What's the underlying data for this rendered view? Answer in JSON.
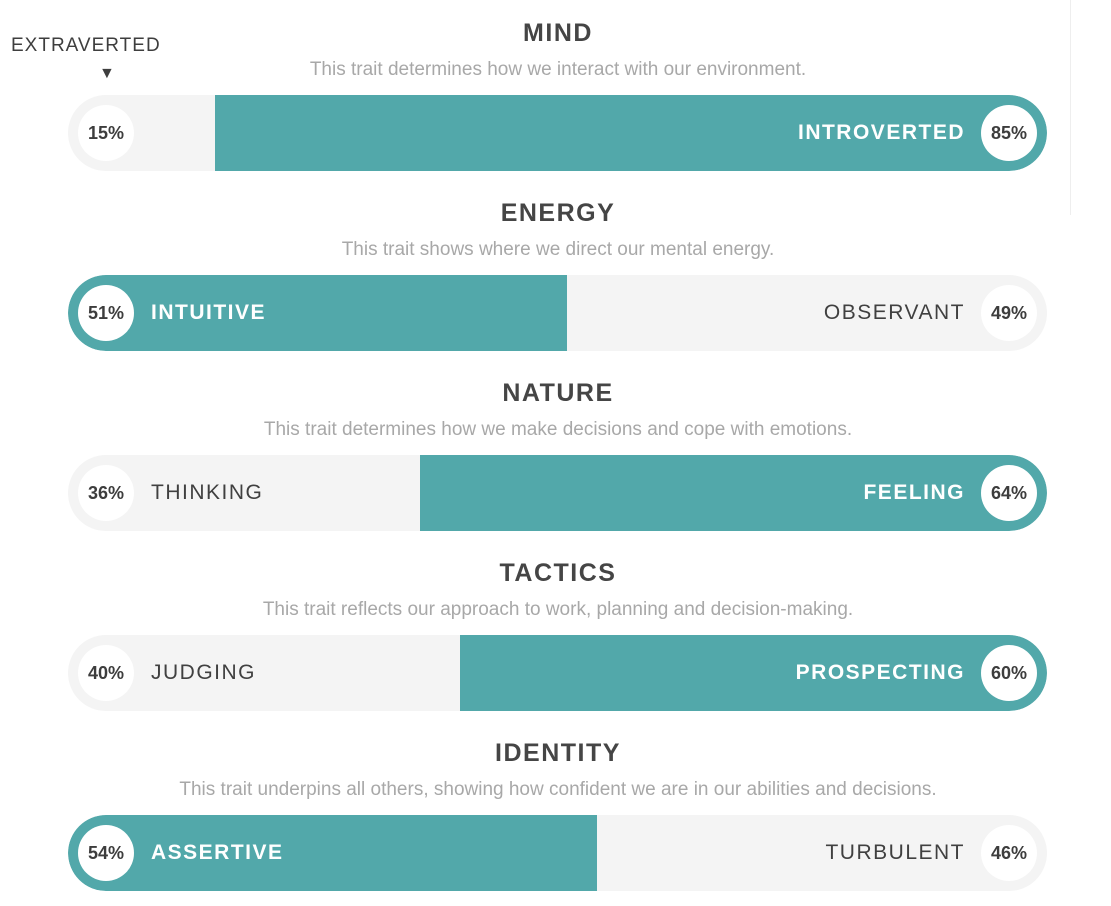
{
  "marker": {
    "label": "EXTRAVERTED",
    "arrow": "▼"
  },
  "colors": {
    "fill": "#52a8aa",
    "track": "#f4f4f4",
    "text_dark": "#454545",
    "text_muted": "#a8a8a8"
  },
  "traits": [
    {
      "title": "MIND",
      "description": "This trait determines how we interact with our environment.",
      "left": {
        "label": "",
        "percent": "15%"
      },
      "right": {
        "label": "INTROVERTED",
        "percent": "85%"
      },
      "dominant": "right",
      "dominant_percent": 85
    },
    {
      "title": "ENERGY",
      "description": "This trait shows where we direct our mental energy.",
      "left": {
        "label": "INTUITIVE",
        "percent": "51%"
      },
      "right": {
        "label": "OBSERVANT",
        "percent": "49%"
      },
      "dominant": "left",
      "dominant_percent": 51
    },
    {
      "title": "NATURE",
      "description": "This trait determines how we make decisions and cope with emotions.",
      "left": {
        "label": "THINKING",
        "percent": "36%"
      },
      "right": {
        "label": "FEELING",
        "percent": "64%"
      },
      "dominant": "right",
      "dominant_percent": 64
    },
    {
      "title": "TACTICS",
      "description": "This trait reflects our approach to work, planning and decision-making.",
      "left": {
        "label": "JUDGING",
        "percent": "40%"
      },
      "right": {
        "label": "PROSPECTING",
        "percent": "60%"
      },
      "dominant": "right",
      "dominant_percent": 60
    },
    {
      "title": "IDENTITY",
      "description": "This trait underpins all others, showing how confident we are in our abilities and decisions.",
      "left": {
        "label": "ASSERTIVE",
        "percent": "54%"
      },
      "right": {
        "label": "TURBULENT",
        "percent": "46%"
      },
      "dominant": "left",
      "dominant_percent": 54
    }
  ]
}
